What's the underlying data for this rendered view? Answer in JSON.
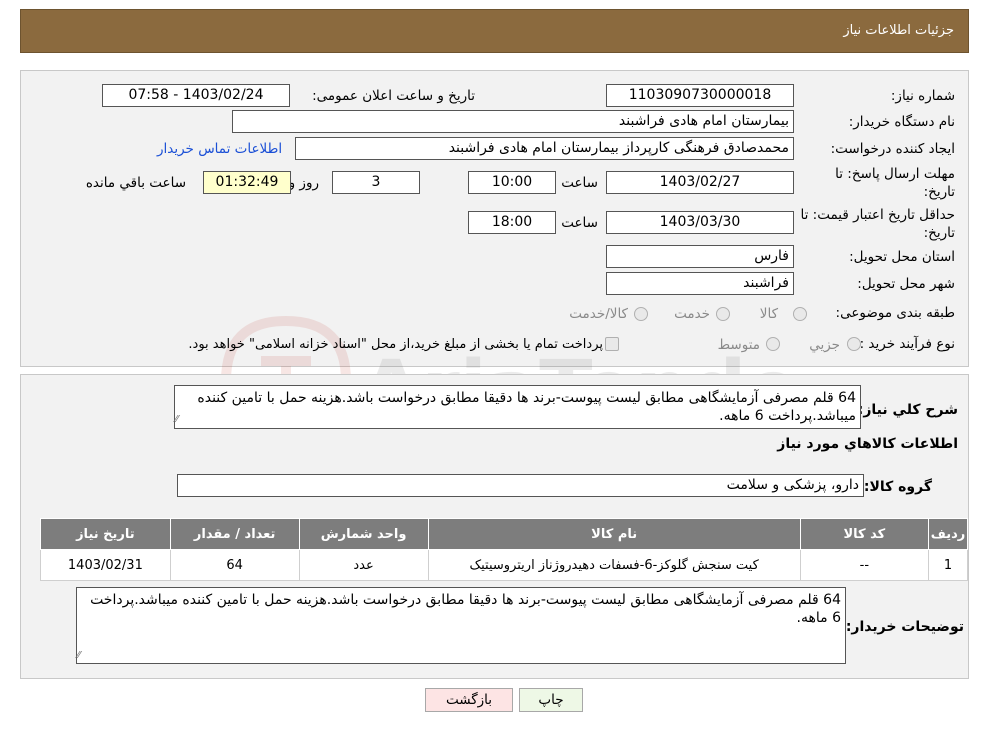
{
  "header": {
    "title": "جزئیات اطلاعات نیاز"
  },
  "form": {
    "need_number_label": "شماره نیاز:",
    "need_number": "1103090730000018",
    "announce_label": "تاریخ و ساعت اعلان عمومی:",
    "announce_value": "1403/02/24 - 07:58",
    "buyer_label": "نام دستگاه خریدار:",
    "buyer_value": "بیمارستان امام هادی فراشبند",
    "creator_label": "ایجاد کننده درخواست:",
    "creator_value": "محمدصادق فرهنگی کارپرداز بیمارستان امام هادی فراشبند",
    "contact_link": "اطلاعات تماس خریدار",
    "deadline_label_1": "مهلت ارسال پاسخ: تا",
    "deadline_label_2": "تاریخ:",
    "deadline_date": "1403/02/27",
    "time_label": "ساعت",
    "deadline_time": "10:00",
    "days_value": "3",
    "days_label": "روز و",
    "remaining_time": "01:32:49",
    "remaining_label": "ساعت باقي مانده",
    "validity_label_1": "حداقل تاریخ اعتبار قیمت: تا",
    "validity_label_2": "تاریخ:",
    "validity_date": "1403/03/30",
    "validity_time": "18:00",
    "province_label": "استان محل تحویل:",
    "province_value": "فارس",
    "city_label": "شهر محل تحویل:",
    "city_value": "فراشبند",
    "category_label": "طبقه بندی موضوعی:",
    "category_options": [
      "کالا",
      "خدمت",
      "کالا/خدمت"
    ],
    "process_label": "نوع فرآیند خرید :",
    "process_options": [
      "جزيي",
      "متوسط"
    ],
    "process_note": "پرداخت تمام یا بخشی از مبلغ خرید،از محل \"اسناد خزانه اسلامی\" خواهد بود."
  },
  "details": {
    "desc_label": "شرح کلي نياز:",
    "desc_text": "64 قلم مصرفی آزمایشگاهی مطابق لیست پیوست-برند ها دقیقا مطابق درخواست باشد.هزینه حمل با تامین کننده میباشد.پرداخت 6 ماهه.",
    "items_title": "اطلاعات کالاهاي مورد نياز",
    "group_label": "گروه کالا:",
    "group_value": "دارو، پزشکی و سلامت",
    "table": {
      "headers": [
        "رديف",
        "کد کالا",
        "نام کالا",
        "واحد شمارش",
        "تعداد / مقدار",
        "تاریخ نیاز"
      ],
      "rows": [
        [
          "1",
          "--",
          "کیت سنجش گلوکز-6-فسفات دهیدروژناز اریتروسیتیک",
          "عدد",
          "64",
          "1403/02/31"
        ]
      ]
    },
    "buyer_notes_label": "توضیحات خریدار:",
    "buyer_notes": "64 قلم مصرفی آزمایشگاهی مطابق لیست پیوست-برند ها دقیقا مطابق درخواست باشد.هزینه حمل با تامین کننده میباشد.پرداخت 6 ماهه."
  },
  "buttons": {
    "print": "چاپ",
    "back": "بازگشت"
  },
  "watermark": {
    "text": "AriaTender.neT"
  },
  "colors": {
    "header": "#8b6a3e",
    "table_header": "#7d7d7d",
    "back_button": "#fde4e4",
    "print_button": "#eef8e6",
    "link": "#1a4fd6"
  }
}
